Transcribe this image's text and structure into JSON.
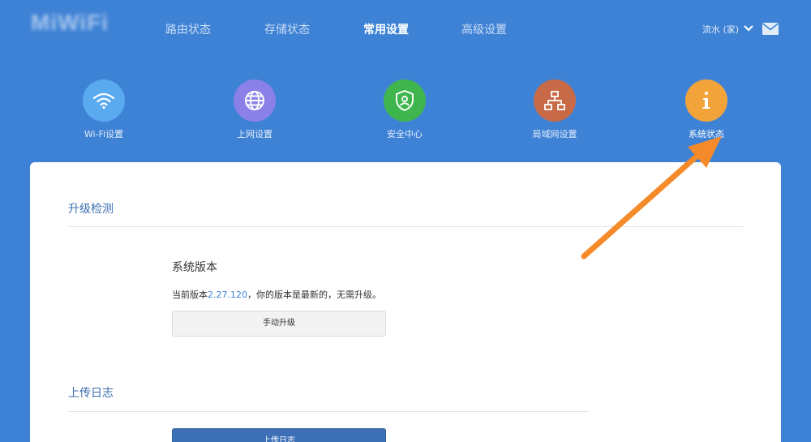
{
  "brand": {
    "logo_text": "MiWiFi"
  },
  "nav": {
    "items": [
      {
        "label": "路由状态"
      },
      {
        "label": "存储状态"
      },
      {
        "label": "常用设置"
      },
      {
        "label": "高级设置"
      }
    ],
    "active_index": 2
  },
  "user": {
    "name": "流水 (家)",
    "menu_icon": "chevron-down-icon",
    "mail_icon": "mail-icon"
  },
  "tiles": [
    {
      "label": "Wi-Fi设置",
      "icon": "wifi-icon",
      "color": "#5aaaf0"
    },
    {
      "label": "上网设置",
      "icon": "globe-icon",
      "color": "#8a80e8"
    },
    {
      "label": "安全中心",
      "icon": "shield-icon",
      "color": "#3fb54e"
    },
    {
      "label": "局域网设置",
      "icon": "network-icon",
      "color": "#c86a48"
    },
    {
      "label": "系统状态",
      "icon": "info-icon",
      "color": "#f2a33a"
    }
  ],
  "upgrade": {
    "section_title": "升级检测",
    "subtitle": "系统版本",
    "version_prefix": "当前版本",
    "version": "2.27.120",
    "version_suffix": "，你的版本是最新的，无需升级。",
    "manual_button": "手动升级"
  },
  "logs": {
    "section_title": "上传日志",
    "upload_button": "上传日志"
  },
  "colors": {
    "background": "#3e82d6",
    "panel": "#ffffff",
    "accent_text": "#3b6eb0",
    "annotation_arrow": "#f58a2a"
  }
}
